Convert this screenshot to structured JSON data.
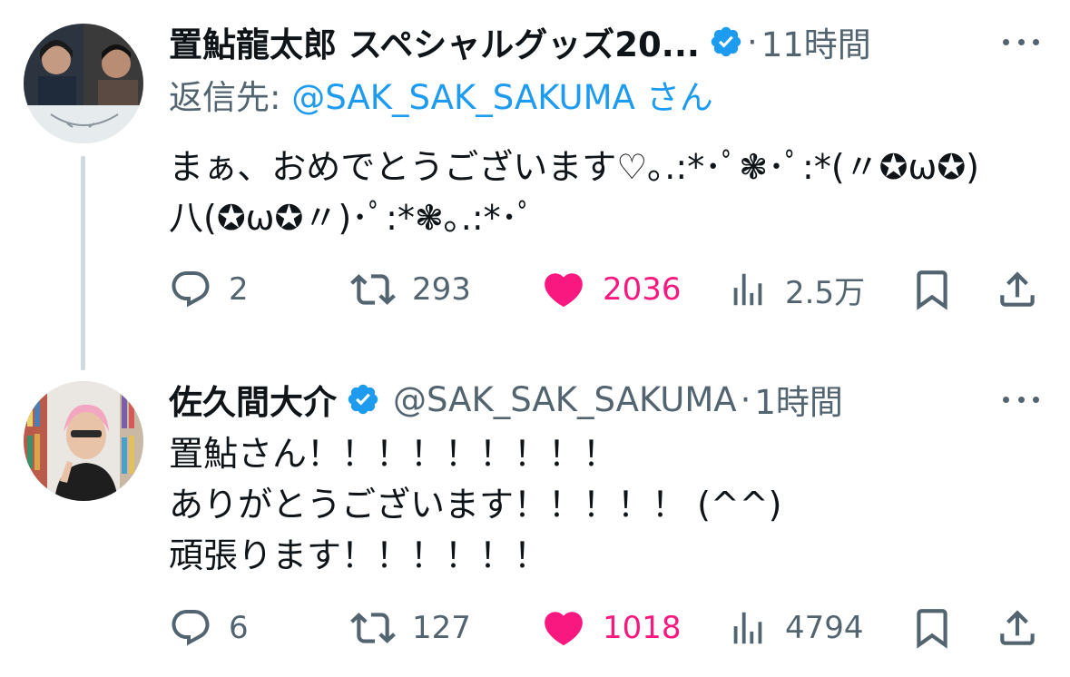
{
  "tweets": [
    {
      "author_name": "置鮎龍太郎 スペシャルグッズ20...",
      "dot": "·",
      "time": "11時間",
      "reply_prefix": "返信先: ",
      "reply_mention": "@SAK_SAK_SAKUMA",
      "reply_suffix": "さん",
      "text": "まぁ、おめでとうございます♡｡.:*･ﾟ❃･ﾟ:*(〃✪ω✪)\n八(✪ω✪〃)･ﾟ:*❃｡.:*･ﾟ",
      "replies": "2",
      "retweets": "293",
      "likes": "2036",
      "views": "2.5万"
    },
    {
      "author_name": "佐久間大介",
      "handle": "@SAK_SAK_SAKUMA",
      "dot": "·",
      "time": "1時間",
      "text": "置鮎さん！！！！！！！！！\nありがとうございます！！！！！ (^^)\n頑張ります！！！！！！",
      "replies": "6",
      "retweets": "127",
      "likes": "1018",
      "views": "4794"
    }
  ],
  "colors": {
    "accent": "#1d9bf0",
    "like": "#f91880",
    "muted": "#536471",
    "thread_line": "#cfd9de"
  },
  "icons": [
    "reply-icon",
    "retweet-icon",
    "like-icon",
    "views-icon",
    "bookmark-icon",
    "share-icon",
    "verified-badge-icon",
    "more-icon"
  ]
}
